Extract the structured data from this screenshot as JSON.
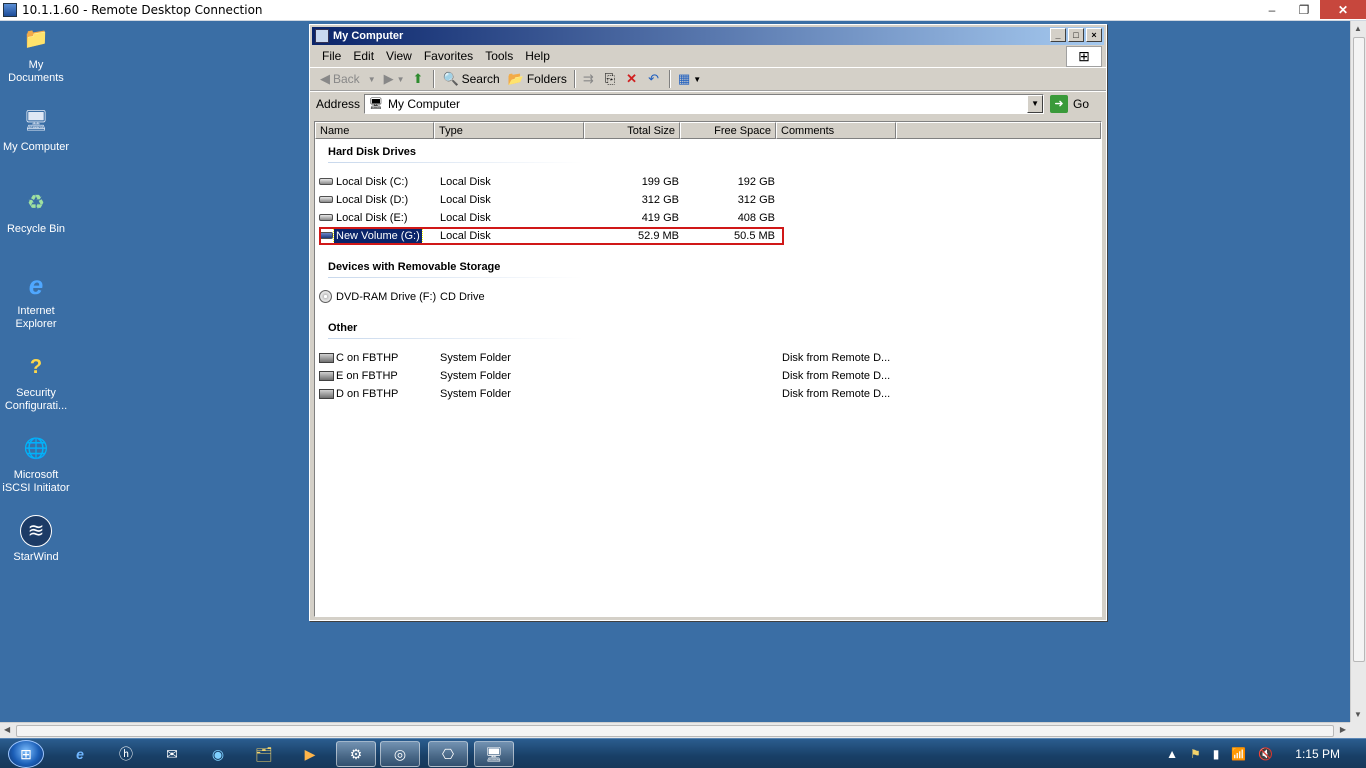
{
  "rdp": {
    "title": "10.1.1.60 - Remote Desktop Connection",
    "min": "–",
    "restore": "❐",
    "close": "✕"
  },
  "desktop_icons": [
    {
      "label": "My Documents",
      "glyph": "📁"
    },
    {
      "label": "My Computer",
      "glyph": "🖥"
    },
    {
      "label": "Recycle Bin",
      "glyph": "♻"
    },
    {
      "label": "Internet Explorer",
      "glyph": "e"
    },
    {
      "label": "Security Configurati...",
      "glyph": "?"
    },
    {
      "label": "Microsoft iSCSI Initiator",
      "glyph": "🌐"
    },
    {
      "label": "StarWind",
      "glyph": "≋"
    }
  ],
  "window": {
    "title": "My Computer",
    "menu": [
      "File",
      "Edit",
      "View",
      "Favorites",
      "Tools",
      "Help"
    ],
    "toolbar": {
      "back": "Back",
      "search": "Search",
      "folders": "Folders"
    },
    "address": {
      "label": "Address",
      "value": "My Computer",
      "go": "Go"
    },
    "columns": {
      "name": "Name",
      "type": "Type",
      "total": "Total Size",
      "free": "Free Space",
      "comments": "Comments"
    },
    "groups": {
      "hard": "Hard Disk Drives",
      "removable": "Devices with Removable Storage",
      "other": "Other"
    },
    "hard_drives": [
      {
        "name": "Local Disk (C:)",
        "type": "Local Disk",
        "total": "199 GB",
        "free": "192 GB"
      },
      {
        "name": "Local Disk (D:)",
        "type": "Local Disk",
        "total": "312 GB",
        "free": "312 GB"
      },
      {
        "name": "Local Disk (E:)",
        "type": "Local Disk",
        "total": "419 GB",
        "free": "408 GB"
      },
      {
        "name": "New Volume (G:)",
        "type": "Local Disk",
        "total": "52.9 MB",
        "free": "50.5 MB"
      }
    ],
    "removable": [
      {
        "name": "DVD-RAM Drive (F:)",
        "type": "CD Drive"
      }
    ],
    "other": [
      {
        "name": "C on FBTHP",
        "type": "System Folder",
        "comment": "Disk from Remote D..."
      },
      {
        "name": "E on FBTHP",
        "type": "System Folder",
        "comment": "Disk from Remote D..."
      },
      {
        "name": "D on FBTHP",
        "type": "System Folder",
        "comment": "Disk from Remote D..."
      }
    ]
  },
  "taskbar": {
    "clock": "1:15 PM"
  },
  "colors": {
    "desktop": "#3a6ea5",
    "highlight": "#d01818",
    "selection": "#0a246a"
  }
}
